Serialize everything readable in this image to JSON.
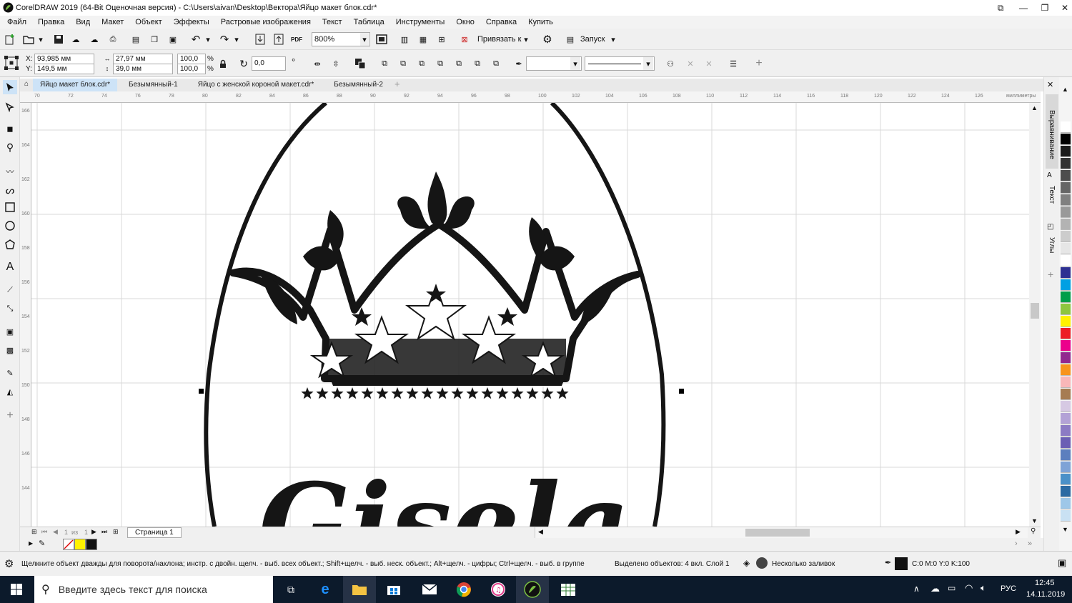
{
  "window": {
    "title": "CorelDRAW 2019 (64-Bit Оценочная версия) - C:\\Users\\aivan\\Desktop\\Вектора\\Яйцо макет блок.cdr*"
  },
  "menu": [
    "Файл",
    "Правка",
    "Вид",
    "Макет",
    "Объект",
    "Эффекты",
    "Растровые изображения",
    "Текст",
    "Таблица",
    "Инструменты",
    "Окно",
    "Справка",
    "Купить"
  ],
  "toolbar": {
    "zoom": "800%",
    "snap_label": "Привязать к",
    "launch_label": "Запуск"
  },
  "properties": {
    "x": "93,985 мм",
    "y": "149,5 мм",
    "width": "27,97 мм",
    "height": "39,0 мм",
    "scale_x": "100,0",
    "scale_y": "100,0",
    "percent": "%",
    "x_label": "X:",
    "y_label": "Y:",
    "rotation": "0,0",
    "degree": "°"
  },
  "tabs": [
    {
      "label": "Яйцо макет блок.cdr*",
      "active": true
    },
    {
      "label": "Безымянный-1",
      "active": false
    },
    {
      "label": "Яйцо с женской короной  макет.cdr*",
      "active": false
    },
    {
      "label": "Безымянный-2",
      "active": false
    }
  ],
  "ruler": {
    "h_ticks": [
      "70",
      "72",
      "74",
      "76",
      "78",
      "80",
      "82",
      "84",
      "86",
      "88",
      "90",
      "92",
      "94",
      "96",
      "98",
      "100",
      "102",
      "104",
      "106",
      "108",
      "110",
      "112",
      "114",
      "116",
      "118",
      "120",
      "122",
      "124",
      "126"
    ],
    "h_unit": "миллиметры",
    "v_ticks": [
      "166",
      "164",
      "162",
      "160",
      "158",
      "156",
      "154",
      "152",
      "150",
      "148",
      "146",
      "144"
    ]
  },
  "artwork": {
    "name_text": "Gisela"
  },
  "right_panel": {
    "dockers": [
      "Выравнивание",
      "Текст",
      "Углы"
    ]
  },
  "palette": [
    "#ffffff",
    "#000000",
    "#1a1a1a",
    "#333333",
    "#4d4d4d",
    "#666666",
    "#808080",
    "#999999",
    "#b3b3b3",
    "#cccccc",
    "#e6e6e6",
    "#ffffff",
    "#2e3192",
    "#00a0e3",
    "#009e49",
    "#8dc63f",
    "#fff200",
    "#ed1c24",
    "#ec008c",
    "#92278f",
    "#f7941d",
    "#f9b7b8",
    "#a67c52",
    "#d6c9e3",
    "#b3a2d6",
    "#8c7bc4",
    "#6b5fb4",
    "#5c7fbe",
    "#7fa3d6",
    "#4a90c8",
    "#2b6aa3",
    "#9ec7e8",
    "#c9e1f3"
  ],
  "page_nav": {
    "current": "1",
    "of": "из",
    "total": "1",
    "page_tab": "Страница 1"
  },
  "status": {
    "hint": "Щелкните объект дважды для поворота/наклона; инстр. с двойн. щелч. - выб. всех объект.; Shift+щелч. - выб. неск. объект.; Alt+щелч. - цифры; Ctrl+щелч. - выб. в группе",
    "selection": "Выделено объектов: 4 вкл. Слой 1",
    "fill": "Несколько заливок",
    "color": "C:0 M:0 Y:0 K:100"
  },
  "taskbar": {
    "search_placeholder": "Введите здесь текст для поиска",
    "lang": "РУС",
    "time": "12:45",
    "date": "14.11.2019"
  }
}
